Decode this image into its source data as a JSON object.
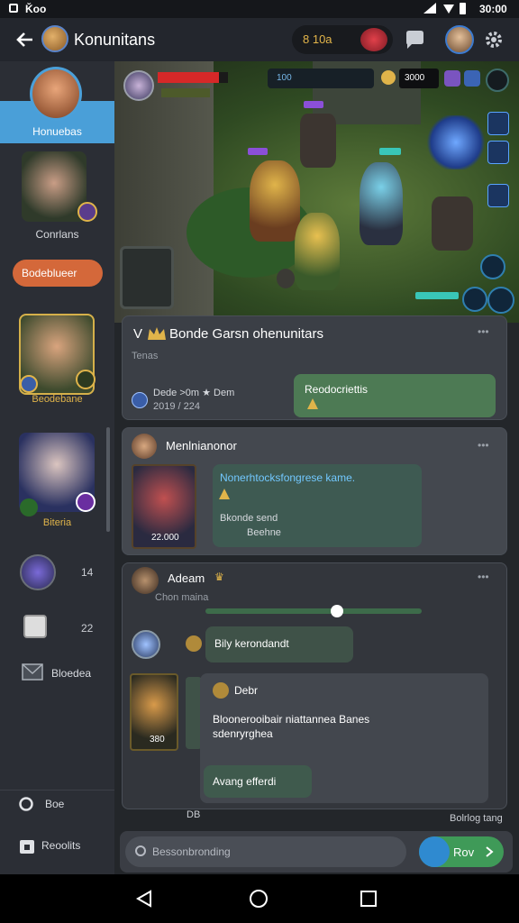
{
  "status": {
    "left": "Ǩoo",
    "time": "30:00"
  },
  "appbar": {
    "title": "Konunitans",
    "gold_value": "8 10a"
  },
  "sidebar": {
    "items": [
      {
        "label": "Honuebas",
        "active": true
      },
      {
        "label": "Conrlans"
      },
      {
        "label": "Bodeblueer"
      },
      {
        "label": "Beodebane"
      },
      {
        "label": "Biteria"
      },
      {
        "count": "14"
      },
      {
        "count": "22"
      },
      {
        "label": "Bloedea"
      }
    ],
    "bottom": [
      {
        "label": "Boe"
      },
      {
        "label": "Reoolits"
      }
    ]
  },
  "game": {
    "score_left": "100",
    "score_right": "3000"
  },
  "post1": {
    "prefix": "V",
    "title": "Bonde Garsn ohenunitars",
    "subtitle": "Tenas",
    "stat_a": "Dede >0m ★ Dem",
    "stat_b": "2019 / 224",
    "reply": "Reodocriettis"
  },
  "post2": {
    "author": "Menlnianonor",
    "card_value": "22.000",
    "message": "Nonerhtocksfongrese kame.",
    "line2": "Bkonde send",
    "line3": "Beehne"
  },
  "post3": {
    "author": "Adeam",
    "subtitle": "Chon maina",
    "slider_value": 0.61,
    "reply": "Bily kerondandt",
    "card_value": "380",
    "quote_author": "Debr",
    "quote_text_1": "Bloonerooibair niattannea Banes",
    "quote_text_2": "sdenryrghea",
    "quote_footer": "Avang efferdi",
    "tail_left": "DB",
    "tail_right": "Bolrlog tang"
  },
  "composer": {
    "placeholder": "Bessonbronding",
    "send_label": "Rov"
  }
}
